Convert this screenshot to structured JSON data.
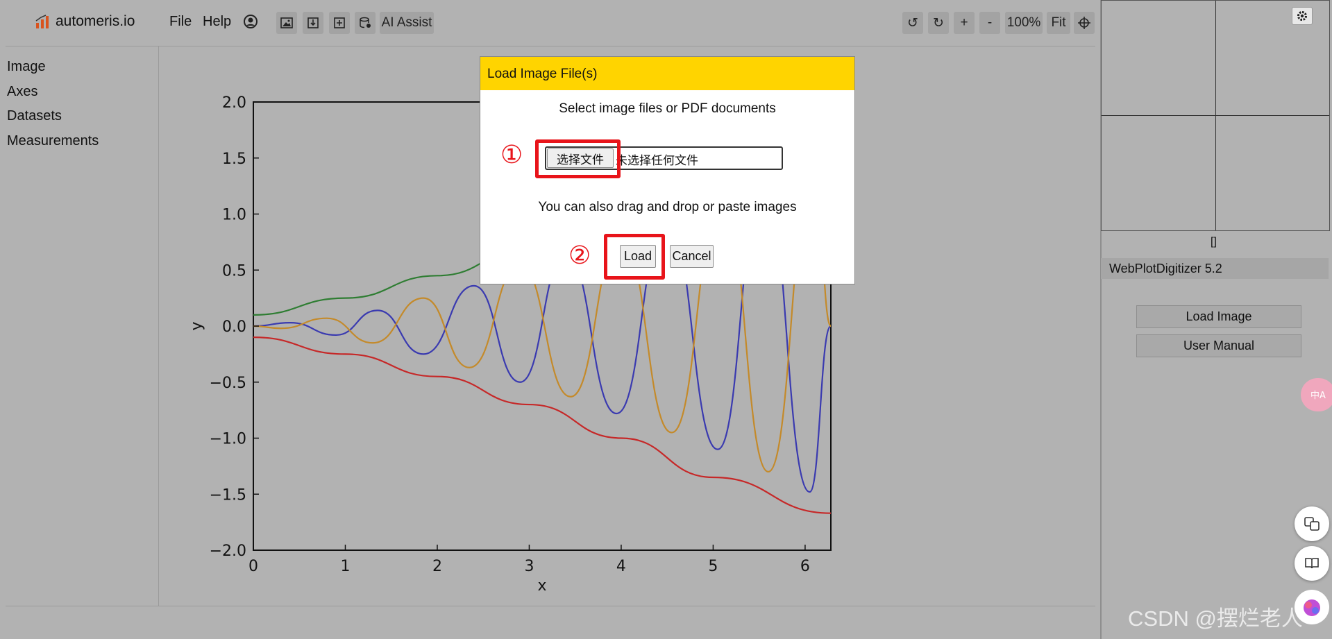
{
  "app": {
    "name": "automeris.io"
  },
  "menu": {
    "file": "File",
    "help": "Help"
  },
  "toolbar": {
    "ai_assist": "AI Assist",
    "rotate_left": "↺",
    "rotate_right": "↻",
    "zoom_in": "+",
    "zoom_out": "-",
    "zoom_level": "100%",
    "fit": "Fit"
  },
  "nav": {
    "items": [
      "Image",
      "Axes",
      "Datasets",
      "Measurements"
    ]
  },
  "right_panel": {
    "selection_readout": "[]",
    "version": "WebPlotDigitizer 5.2",
    "load_image": "Load Image",
    "user_manual": "User Manual"
  },
  "dialog": {
    "title": "Load Image File(s)",
    "subtitle": "Select image files or PDF documents",
    "choose_file": "选择文件",
    "no_file": "未选择任何文件",
    "drag_hint": "You can also drag and drop or paste images",
    "load": "Load",
    "cancel": "Cancel",
    "step1": "①",
    "step2": "②"
  },
  "watermark": "CSDN @摆烂老人",
  "colors": {
    "highlight": "#e8141a",
    "dialog_header": "#ffd400",
    "series_blue": "#3a3ab0",
    "series_orange": "#c48a2a",
    "series_green": "#2e7d32",
    "series_red": "#c62828"
  },
  "chart_data": {
    "type": "line",
    "xlabel": "x",
    "ylabel": "y",
    "xlim": [
      0,
      6.28
    ],
    "ylim": [
      -2.0,
      2.0
    ],
    "x_ticks": [
      "0",
      "1",
      "2",
      "3",
      "4",
      "5",
      "6"
    ],
    "y_ticks": [
      "2.0",
      "1.5",
      "1.0",
      "0.5",
      "0.0",
      "−0.5",
      "−1.0",
      "−1.5",
      "−2.0"
    ],
    "series": [
      {
        "color": "#2e7d32",
        "x": [
          0,
          1,
          2,
          3,
          4,
          5,
          6.28
        ],
        "y": [
          0.1,
          0.25,
          0.45,
          0.7,
          1.0,
          1.35,
          1.65
        ]
      },
      {
        "color": "#c62828",
        "x": [
          0,
          1,
          2,
          3,
          4,
          5,
          6.28
        ],
        "y": [
          -0.1,
          -0.25,
          -0.45,
          -0.7,
          -1.0,
          -1.35,
          -1.67
        ]
      },
      {
        "color": "#3a3ab0",
        "x": [
          0,
          0.4,
          0.9,
          1.35,
          1.85,
          2.4,
          2.9,
          3.4,
          3.95,
          4.5,
          5.05,
          5.55,
          6.05,
          6.28
        ],
        "y": [
          0.0,
          0.03,
          -0.08,
          0.14,
          -0.25,
          0.36,
          -0.5,
          0.65,
          -0.78,
          0.95,
          -1.1,
          1.3,
          -1.48,
          0.0
        ]
      },
      {
        "color": "#c48a2a",
        "x": [
          0,
          0.3,
          0.8,
          1.3,
          1.85,
          2.35,
          2.9,
          3.45,
          4.0,
          4.55,
          5.1,
          5.6,
          6.1,
          6.28
        ],
        "y": [
          0.0,
          -0.02,
          0.07,
          -0.15,
          0.25,
          -0.37,
          0.55,
          -0.63,
          0.8,
          -0.95,
          1.15,
          -1.3,
          1.4,
          0.0
        ]
      }
    ]
  }
}
